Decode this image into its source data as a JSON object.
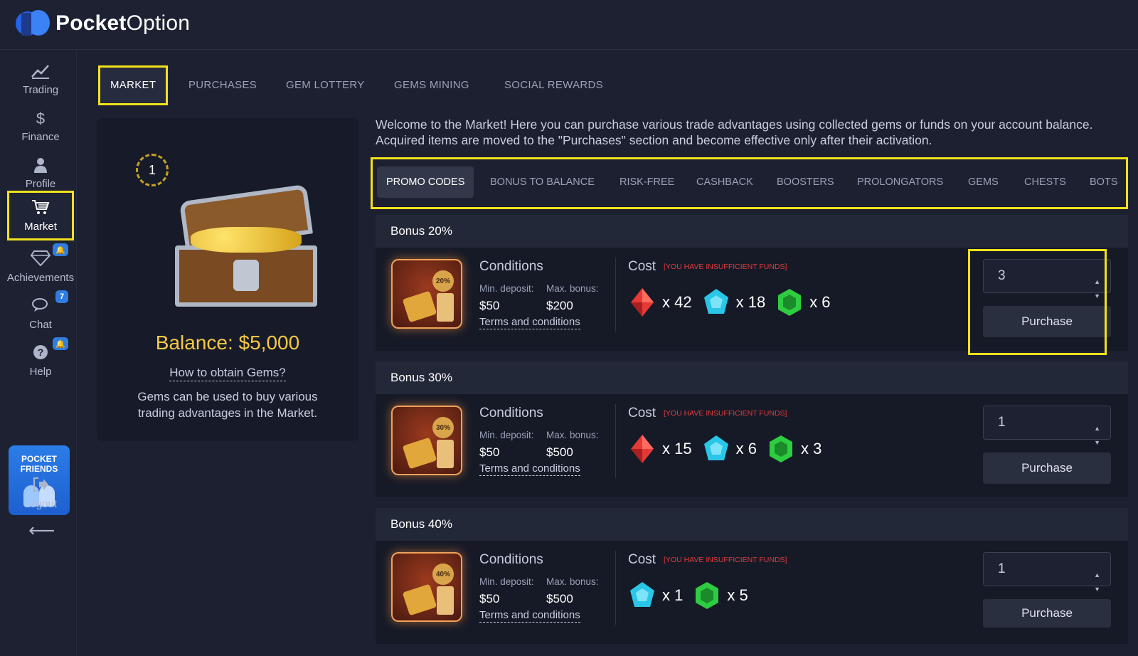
{
  "brand": {
    "bold": "Pocket",
    "light": "Option"
  },
  "sidebar": {
    "items": [
      {
        "label": "Trading",
        "icon": "chart-line-icon"
      },
      {
        "label": "Finance",
        "icon": "dollar-icon"
      },
      {
        "label": "Profile",
        "icon": "user-icon"
      },
      {
        "label": "Market",
        "icon": "cart-icon"
      },
      {
        "label": "Achievements",
        "icon": "diamond-icon",
        "badge": ""
      },
      {
        "label": "Chat",
        "icon": "chat-icon",
        "badge": "7"
      },
      {
        "label": "Help",
        "icon": "help-icon",
        "badge": ""
      },
      {
        "label": "Logout",
        "icon": "logout-icon"
      }
    ],
    "friends": {
      "line1": "POCKET",
      "line2": "FRIENDS"
    }
  },
  "tabs": [
    "MARKET",
    "PURCHASES",
    "GEM LOTTERY",
    "GEMS MINING",
    "SOCIAL REWARDS"
  ],
  "panel": {
    "level": "1",
    "balance": "Balance: $5,000",
    "how_link": "How to obtain Gems?",
    "desc": "Gems can be used to buy various trading advantages in the Market."
  },
  "welcome": "Welcome to the Market! Here you can purchase various trade advantages using collected gems or funds on your account balance. Acquired items are moved to the \"Purchases\" section and become effective only after their activation.",
  "subtabs": [
    "PROMO CODES",
    "BONUS TO BALANCE",
    "RISK-FREE",
    "CASHBACK",
    "BOOSTERS",
    "PROLONGATORS",
    "GEMS",
    "CHESTS",
    "BOTS"
  ],
  "labels": {
    "conditions": "Conditions",
    "min_deposit": "Min. deposit:",
    "max_bonus": "Max. bonus:",
    "terms": "Terms and conditions",
    "cost": "Cost",
    "insufficient": "[YOU HAVE INSUFFICIENT FUNDS]",
    "purchase": "Purchase"
  },
  "products": [
    {
      "title": "Bonus 20%",
      "badge": "20%",
      "min_deposit": "$50",
      "max_bonus": "$200",
      "cost": [
        {
          "gem": "red",
          "count": "x 42"
        },
        {
          "gem": "blue",
          "count": "x 18"
        },
        {
          "gem": "green",
          "count": "x 6"
        }
      ],
      "qty": "3"
    },
    {
      "title": "Bonus 30%",
      "badge": "30%",
      "min_deposit": "$50",
      "max_bonus": "$500",
      "cost": [
        {
          "gem": "red",
          "count": "x 15"
        },
        {
          "gem": "blue",
          "count": "x 6"
        },
        {
          "gem": "green",
          "count": "x 3"
        }
      ],
      "qty": "1"
    },
    {
      "title": "Bonus 40%",
      "badge": "40%",
      "min_deposit": "$50",
      "max_bonus": "$500",
      "cost": [
        {
          "gem": "blue",
          "count": "x 1"
        },
        {
          "gem": "green",
          "count": "x 5"
        }
      ],
      "qty": "1"
    }
  ],
  "colors": {
    "highlight": "#f2e11b",
    "balance": "#f7c843",
    "warning": "#e23b3b",
    "gem_red": "#e53935",
    "gem_blue": "#29c6e8",
    "gem_green": "#2ecc40"
  }
}
